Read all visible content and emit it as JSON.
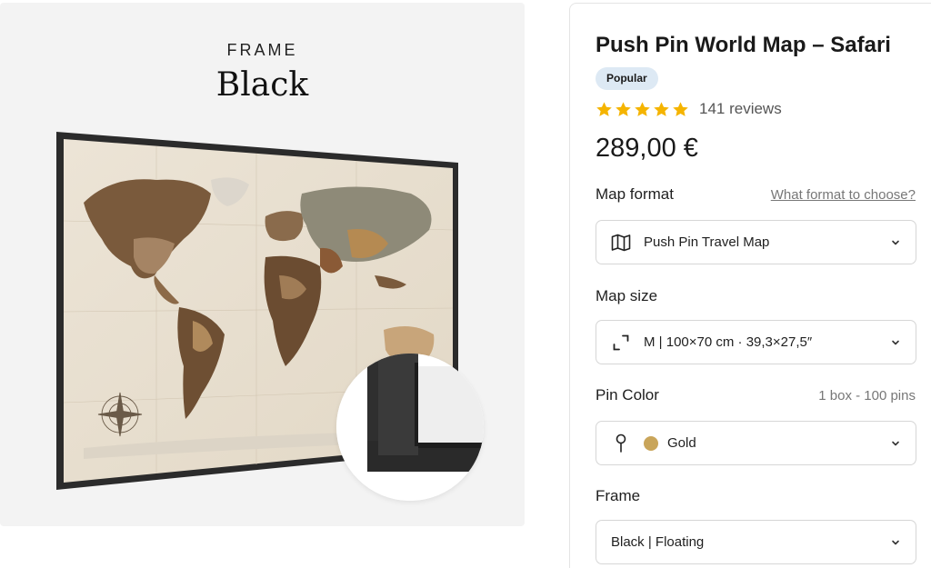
{
  "gallery": {
    "frame_label": "FRAME",
    "frame_value": "Black"
  },
  "product": {
    "title": "Push Pin World Map – Safari",
    "badge": "Popular",
    "rating": {
      "stars": 5,
      "review_count": "141 reviews",
      "star_color": "#f5b400"
    },
    "price": "289,00 €"
  },
  "options": {
    "map_format": {
      "label": "Map format",
      "help_link": "What format to choose?",
      "value": "Push Pin Travel Map",
      "icon": "map-icon"
    },
    "map_size": {
      "label": "Map size",
      "value": "M | 100×70 cm · 39,3×27,5″",
      "icon": "resize-icon"
    },
    "pin_color": {
      "label": "Pin Color",
      "note": "1 box - 100 pins",
      "value": "Gold",
      "swatch_color": "#c9a55a",
      "icon": "pin-icon"
    },
    "frame": {
      "label": "Frame",
      "value": "Black | Floating"
    }
  },
  "colors": {
    "accent_badge": "#dde9f4",
    "border": "#d6d6d6"
  }
}
